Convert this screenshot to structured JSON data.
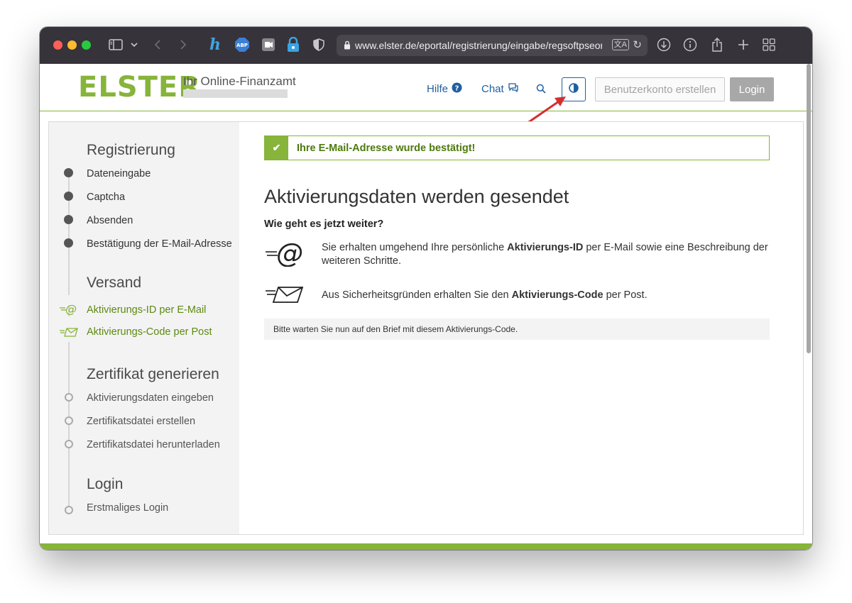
{
  "browser": {
    "url": "www.elster.de/eportal/registrierung/eingabe/regsoftpseor",
    "toolbar_icons": [
      "sidebar-toggle-icon",
      "chevron-down-icon",
      "back-icon",
      "forward-icon",
      "honey-extension-icon",
      "adblock-plus-icon",
      "camera-extension-icon",
      "password-extension-icon",
      "shield-extension-icon",
      "translate-icon",
      "reload-icon",
      "download-icon",
      "info-icon",
      "share-icon",
      "new-tab-icon",
      "tab-overview-icon"
    ],
    "abp_label": "ABP"
  },
  "header": {
    "logo": "ELSTER",
    "tagline": "Ihr Online-Finanzamt",
    "help_label": "Hilfe",
    "chat_label": "Chat",
    "create_account_label": "Benutzerkonto erstellen",
    "login_label": "Login",
    "accent_color": "#87b43a",
    "link_color": "#1f5fa0"
  },
  "sidebar": {
    "sections": [
      {
        "heading": "Registrierung",
        "items": [
          "Dateneingabe",
          "Captcha",
          "Absenden",
          "Bestätigung der E-Mail-Adresse"
        ],
        "state": "done"
      },
      {
        "heading": "Versand",
        "items": [
          "Aktivierungs-ID per E-Mail",
          "Aktivierungs-Code per Post"
        ],
        "state": "active"
      },
      {
        "heading": "Zertifikat generieren",
        "items": [
          "Aktivierungsdaten eingeben",
          "Zertifikatsdatei erstellen",
          "Zertifikatsdatei herunterladen"
        ],
        "state": "pending"
      },
      {
        "heading": "Login",
        "items": [
          "Erstmaliges Login"
        ],
        "state": "pending"
      }
    ]
  },
  "main": {
    "success_message": "Ihre E-Mail-Adresse wurde bestätigt!",
    "title": "Aktivierungsdaten werden gesendet",
    "subtitle": "Wie geht es jetzt weiter?",
    "email_info": {
      "before": "Sie erhalten umgehend Ihre persönliche ",
      "bold": "Aktivierungs-ID",
      "after": " per E-Mail sowie eine Beschreibung der weiteren Schritte."
    },
    "post_info": {
      "before": "Aus Sicherheitsgründen erhalten Sie den ",
      "bold": "Aktivierungs-Code",
      "after": " per Post."
    },
    "note": "Bitte warten Sie nun auf den Brief mit diesem Aktivierungs-Code."
  }
}
